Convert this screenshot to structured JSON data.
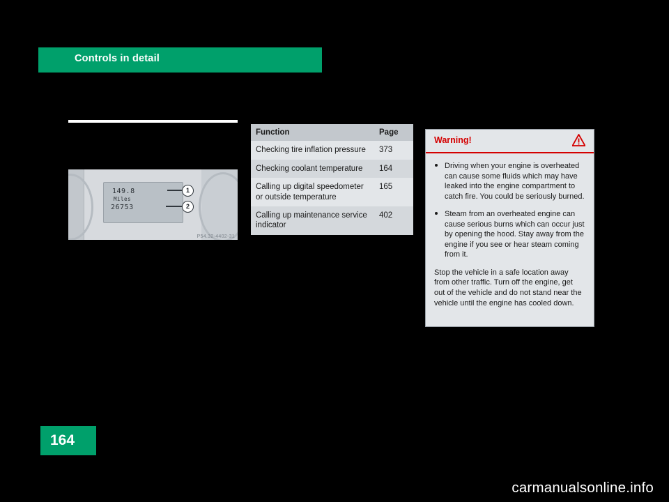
{
  "header": {
    "title": "Controls in detail"
  },
  "figure": {
    "odometer": "149.8",
    "unit": "Miles",
    "trip": "26753",
    "callout_1": "1",
    "callout_2": "2",
    "caption": "P54.32-4402-31"
  },
  "table": {
    "headers": {
      "function": "Function",
      "page": "Page"
    },
    "rows": [
      {
        "function": "Checking tire inflation pressure",
        "page": "373"
      },
      {
        "function": "Checking coolant temperature",
        "page": "164"
      },
      {
        "function": "Calling up digital speedometer or outside temperature",
        "page": "165"
      },
      {
        "function": "Calling up maintenance service indicator",
        "page": "402"
      }
    ]
  },
  "warning": {
    "title": "Warning!",
    "icon": "warning-triangle-icon",
    "bullets": [
      "Driving when your engine is overheated can cause some fluids which may have leaked into the engine compartment to catch fire. You could be seriously burned.",
      "Steam from an overheated engine can cause serious burns which can occur just by opening the hood. Stay away from the engine if you see or hear steam coming from it."
    ],
    "closing": "Stop the vehicle in a safe location away from other traffic. Turn off the engine, get out of the vehicle and do not stand near the vehicle until the engine has cooled down."
  },
  "page_number": "164",
  "footer": "carmanualsonline.info",
  "colors": {
    "accent_green": "#00a06b",
    "warning_red": "#d40000",
    "table_header": "#c3c8cd",
    "table_row": "#e3e6e9",
    "table_row_alt": "#d4d8dc"
  }
}
